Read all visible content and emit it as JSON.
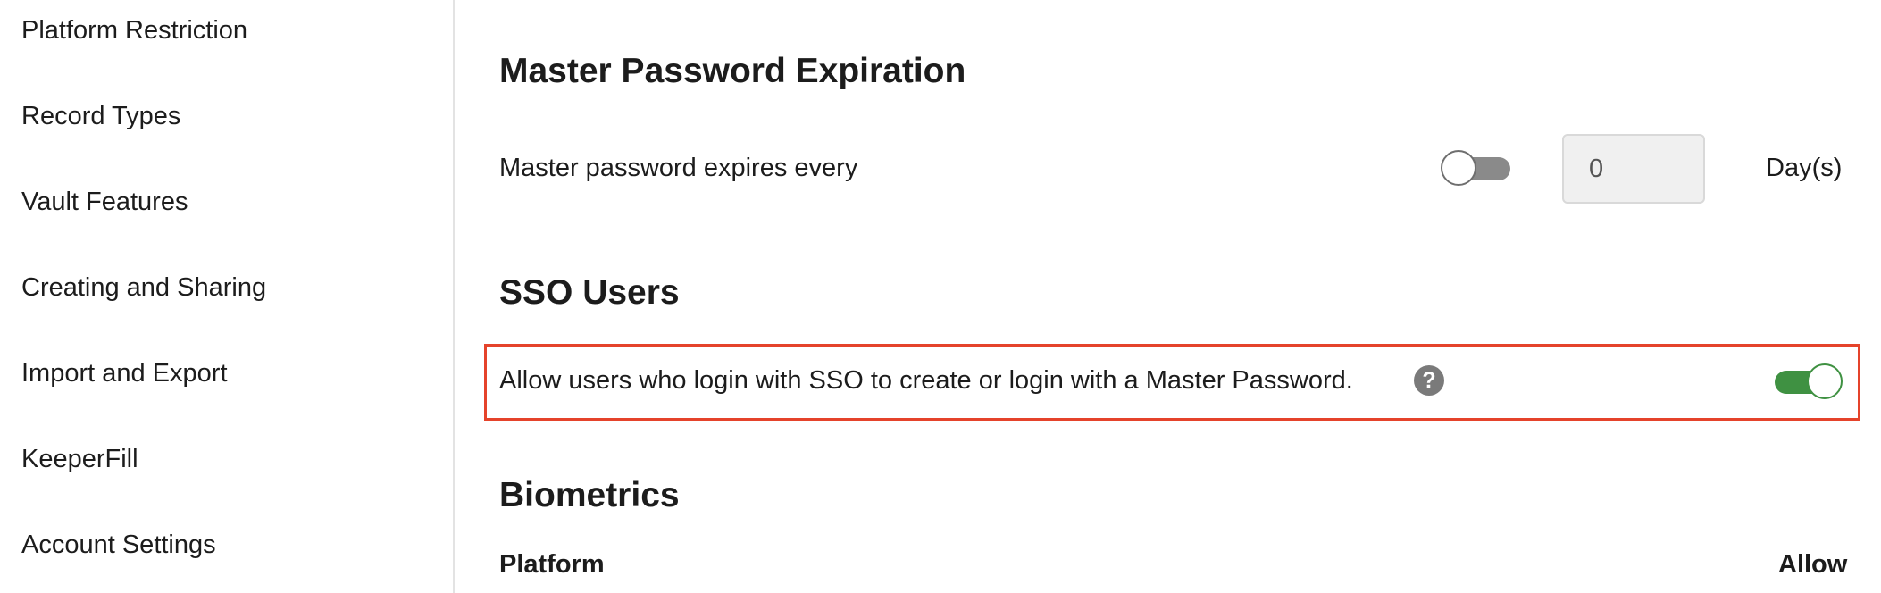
{
  "sidebar": {
    "items": [
      {
        "label": "Platform Restriction"
      },
      {
        "label": "Record Types"
      },
      {
        "label": "Vault Features"
      },
      {
        "label": "Creating and Sharing"
      },
      {
        "label": "Import and Export"
      },
      {
        "label": "KeeperFill"
      },
      {
        "label": "Account Settings"
      }
    ]
  },
  "main": {
    "master_password_expiration": {
      "title": "Master Password Expiration",
      "row_label": "Master password expires every",
      "toggle_state": "off",
      "days_value": "0",
      "unit": "Day(s)"
    },
    "sso_users": {
      "title": "SSO Users",
      "row_label": "Allow users who login with SSO to create or login with a Master Password.",
      "help_icon": "?",
      "toggle_state": "on",
      "highlight_color": "#e5432b"
    },
    "biometrics": {
      "title": "Biometrics",
      "col_platform": "Platform",
      "col_allow": "Allow"
    }
  },
  "colors": {
    "toggle_on": "#3f9142",
    "toggle_off": "#8a8a8a",
    "sidebar_divider": "#e3e3e3"
  }
}
